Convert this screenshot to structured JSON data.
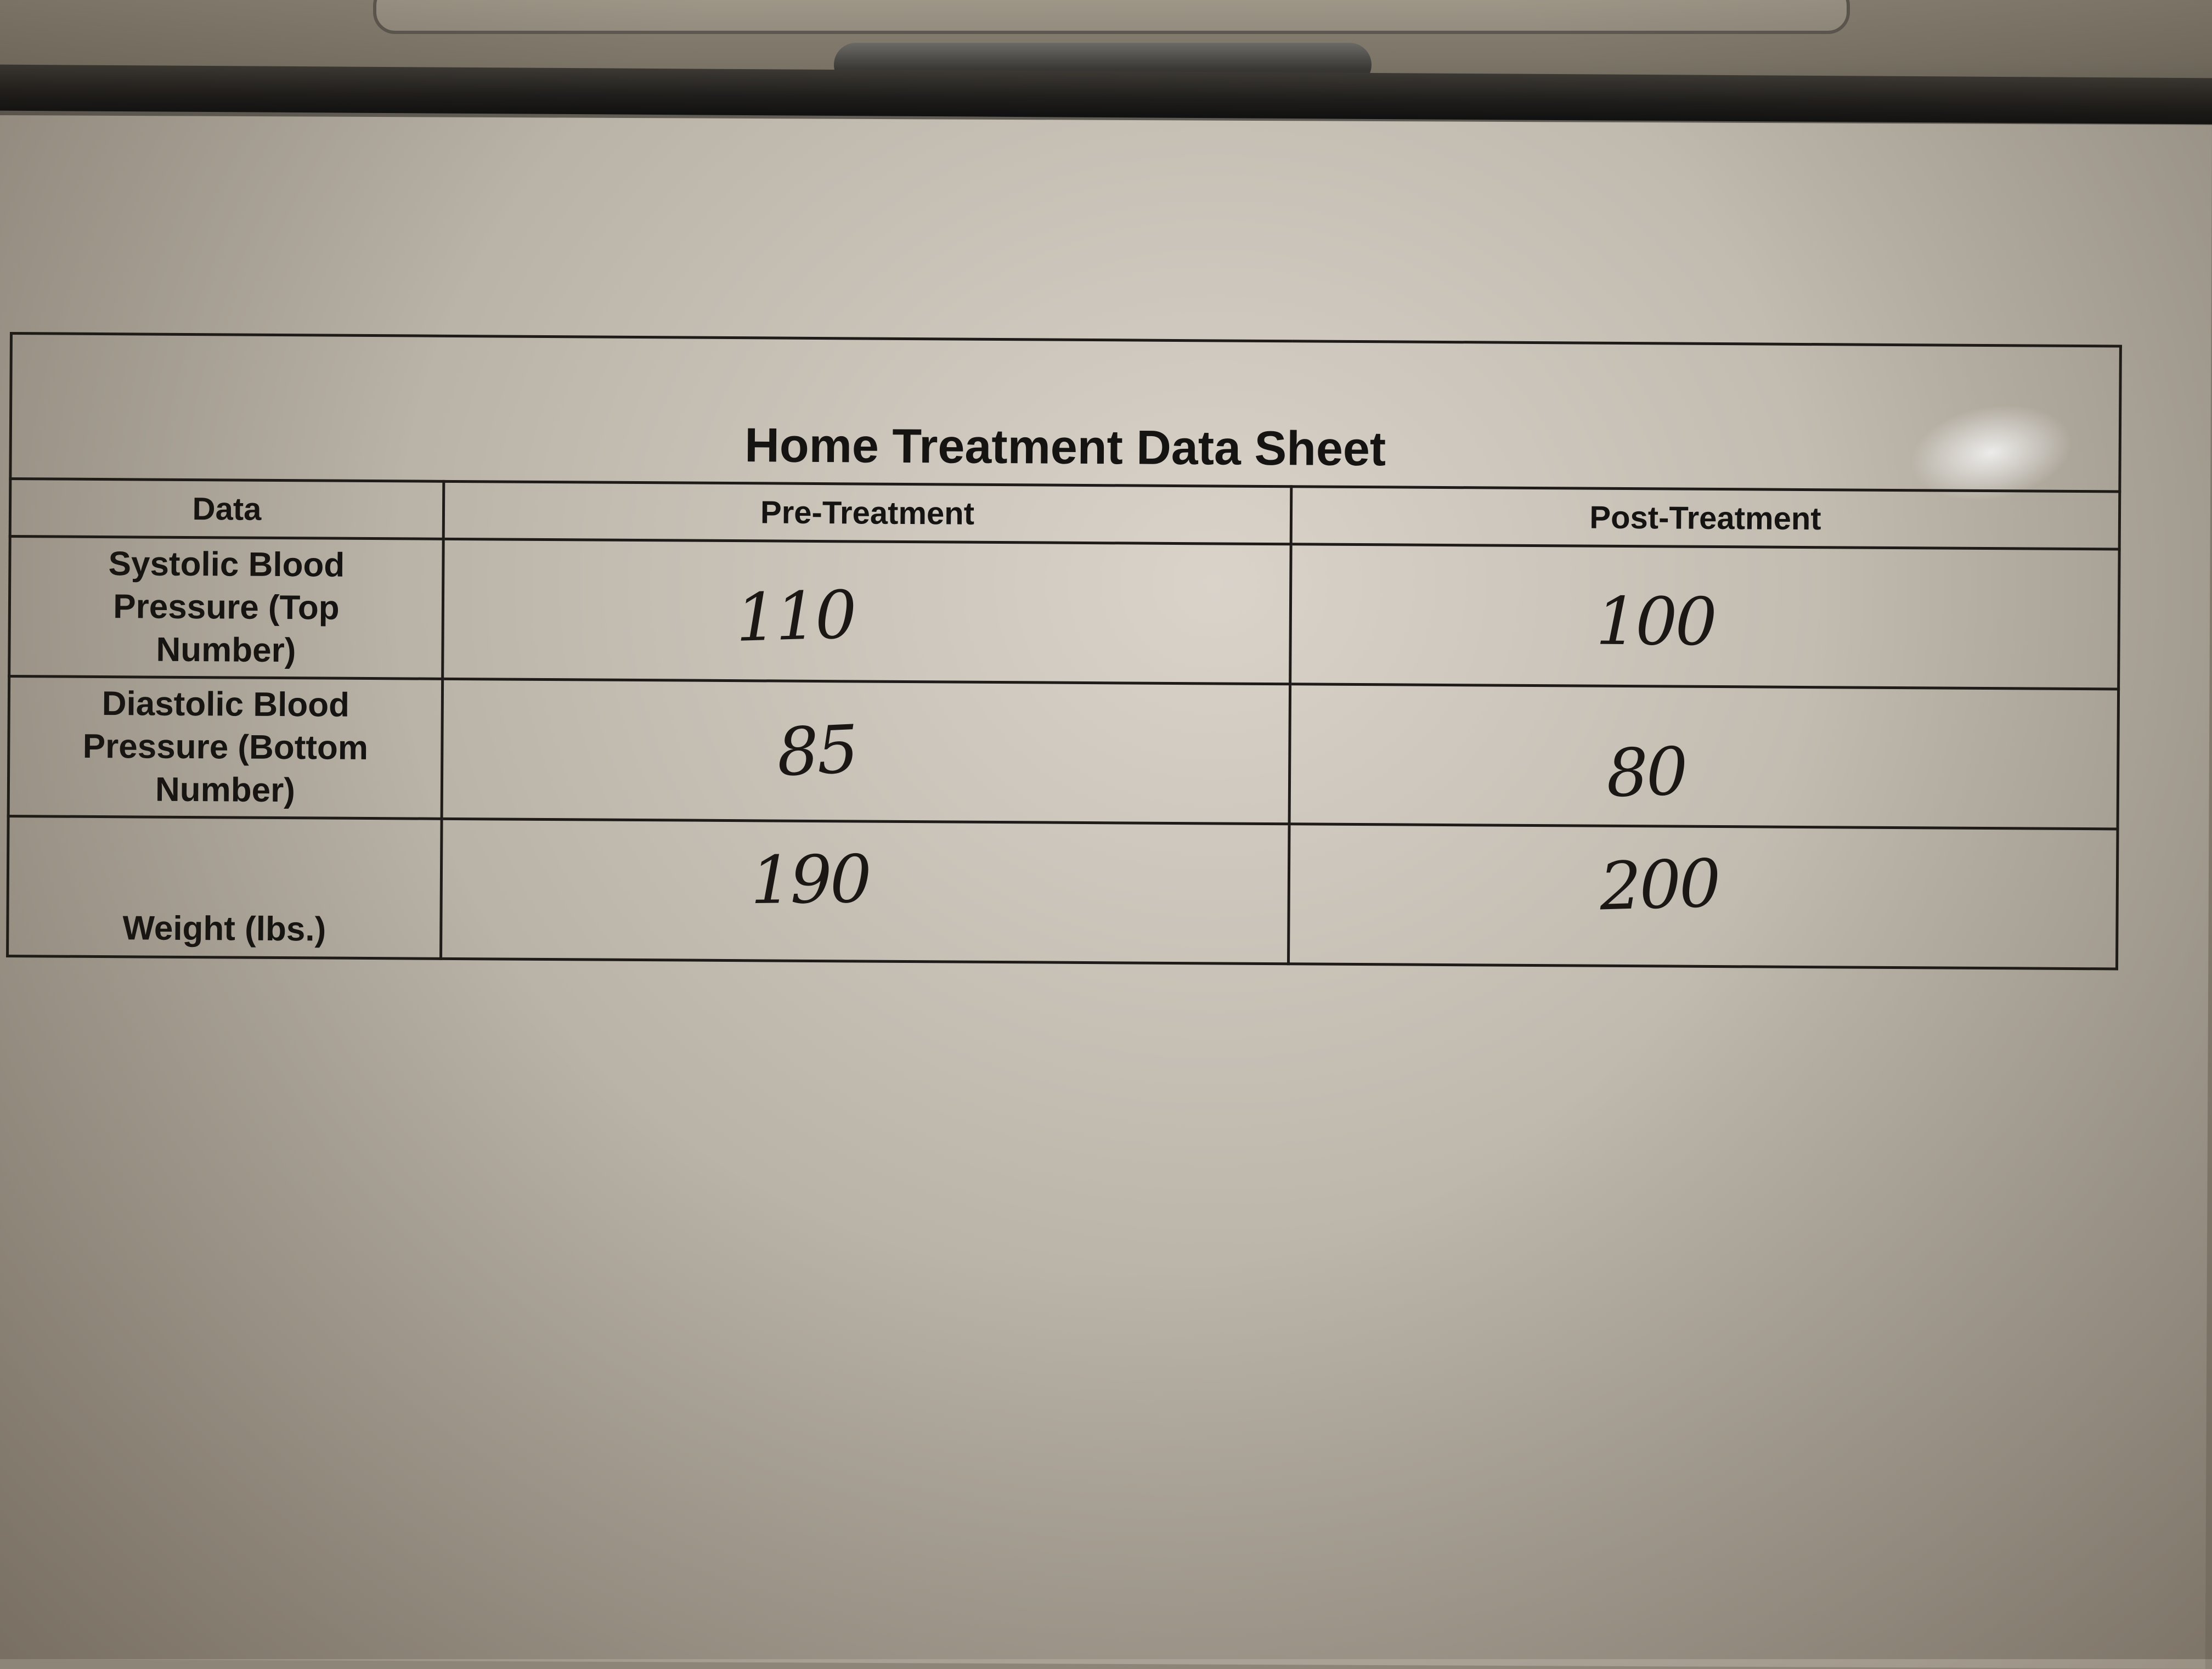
{
  "sheet": {
    "title": "Home Treatment Data Sheet",
    "columns": [
      "Data",
      "Pre-Treatment",
      "Post-Treatment"
    ],
    "rows": [
      {
        "label": "Systolic Blood Pressure (Top Number)",
        "label_lines": [
          "Systolic Blood",
          "Pressure (Top",
          "Number)"
        ],
        "pre": "110",
        "post": "100"
      },
      {
        "label": "Diastolic Blood Pressure (Bottom Number)",
        "label_lines": [
          "Diastolic Blood",
          "Pressure (Bottom",
          "Number)"
        ],
        "pre": "85",
        "post": "80"
      },
      {
        "label": "Weight (lbs.)",
        "label_lines": [
          "Weight (lbs.)"
        ],
        "pre": "190",
        "post": "200"
      }
    ]
  },
  "colors": {
    "ink": "#1a1715",
    "paper": "#c9c3b8",
    "table_border": "#1e1b18",
    "clipboard": "#1f1d1b"
  }
}
